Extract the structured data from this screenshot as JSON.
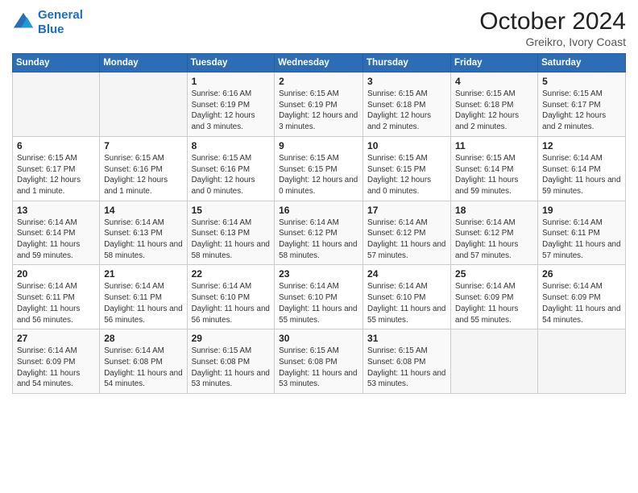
{
  "header": {
    "logo_line1": "General",
    "logo_line2": "Blue",
    "title": "October 2024",
    "location": "Greikro, Ivory Coast"
  },
  "days_of_week": [
    "Sunday",
    "Monday",
    "Tuesday",
    "Wednesday",
    "Thursday",
    "Friday",
    "Saturday"
  ],
  "weeks": [
    [
      {
        "day": "",
        "info": ""
      },
      {
        "day": "",
        "info": ""
      },
      {
        "day": "1",
        "info": "Sunrise: 6:16 AM\nSunset: 6:19 PM\nDaylight: 12 hours and 3 minutes."
      },
      {
        "day": "2",
        "info": "Sunrise: 6:15 AM\nSunset: 6:19 PM\nDaylight: 12 hours and 3 minutes."
      },
      {
        "day": "3",
        "info": "Sunrise: 6:15 AM\nSunset: 6:18 PM\nDaylight: 12 hours and 2 minutes."
      },
      {
        "day": "4",
        "info": "Sunrise: 6:15 AM\nSunset: 6:18 PM\nDaylight: 12 hours and 2 minutes."
      },
      {
        "day": "5",
        "info": "Sunrise: 6:15 AM\nSunset: 6:17 PM\nDaylight: 12 hours and 2 minutes."
      }
    ],
    [
      {
        "day": "6",
        "info": "Sunrise: 6:15 AM\nSunset: 6:17 PM\nDaylight: 12 hours and 1 minute."
      },
      {
        "day": "7",
        "info": "Sunrise: 6:15 AM\nSunset: 6:16 PM\nDaylight: 12 hours and 1 minute."
      },
      {
        "day": "8",
        "info": "Sunrise: 6:15 AM\nSunset: 6:16 PM\nDaylight: 12 hours and 0 minutes."
      },
      {
        "day": "9",
        "info": "Sunrise: 6:15 AM\nSunset: 6:15 PM\nDaylight: 12 hours and 0 minutes."
      },
      {
        "day": "10",
        "info": "Sunrise: 6:15 AM\nSunset: 6:15 PM\nDaylight: 12 hours and 0 minutes."
      },
      {
        "day": "11",
        "info": "Sunrise: 6:15 AM\nSunset: 6:14 PM\nDaylight: 11 hours and 59 minutes."
      },
      {
        "day": "12",
        "info": "Sunrise: 6:14 AM\nSunset: 6:14 PM\nDaylight: 11 hours and 59 minutes."
      }
    ],
    [
      {
        "day": "13",
        "info": "Sunrise: 6:14 AM\nSunset: 6:14 PM\nDaylight: 11 hours and 59 minutes."
      },
      {
        "day": "14",
        "info": "Sunrise: 6:14 AM\nSunset: 6:13 PM\nDaylight: 11 hours and 58 minutes."
      },
      {
        "day": "15",
        "info": "Sunrise: 6:14 AM\nSunset: 6:13 PM\nDaylight: 11 hours and 58 minutes."
      },
      {
        "day": "16",
        "info": "Sunrise: 6:14 AM\nSunset: 6:12 PM\nDaylight: 11 hours and 58 minutes."
      },
      {
        "day": "17",
        "info": "Sunrise: 6:14 AM\nSunset: 6:12 PM\nDaylight: 11 hours and 57 minutes."
      },
      {
        "day": "18",
        "info": "Sunrise: 6:14 AM\nSunset: 6:12 PM\nDaylight: 11 hours and 57 minutes."
      },
      {
        "day": "19",
        "info": "Sunrise: 6:14 AM\nSunset: 6:11 PM\nDaylight: 11 hours and 57 minutes."
      }
    ],
    [
      {
        "day": "20",
        "info": "Sunrise: 6:14 AM\nSunset: 6:11 PM\nDaylight: 11 hours and 56 minutes."
      },
      {
        "day": "21",
        "info": "Sunrise: 6:14 AM\nSunset: 6:11 PM\nDaylight: 11 hours and 56 minutes."
      },
      {
        "day": "22",
        "info": "Sunrise: 6:14 AM\nSunset: 6:10 PM\nDaylight: 11 hours and 56 minutes."
      },
      {
        "day": "23",
        "info": "Sunrise: 6:14 AM\nSunset: 6:10 PM\nDaylight: 11 hours and 55 minutes."
      },
      {
        "day": "24",
        "info": "Sunrise: 6:14 AM\nSunset: 6:10 PM\nDaylight: 11 hours and 55 minutes."
      },
      {
        "day": "25",
        "info": "Sunrise: 6:14 AM\nSunset: 6:09 PM\nDaylight: 11 hours and 55 minutes."
      },
      {
        "day": "26",
        "info": "Sunrise: 6:14 AM\nSunset: 6:09 PM\nDaylight: 11 hours and 54 minutes."
      }
    ],
    [
      {
        "day": "27",
        "info": "Sunrise: 6:14 AM\nSunset: 6:09 PM\nDaylight: 11 hours and 54 minutes."
      },
      {
        "day": "28",
        "info": "Sunrise: 6:14 AM\nSunset: 6:08 PM\nDaylight: 11 hours and 54 minutes."
      },
      {
        "day": "29",
        "info": "Sunrise: 6:15 AM\nSunset: 6:08 PM\nDaylight: 11 hours and 53 minutes."
      },
      {
        "day": "30",
        "info": "Sunrise: 6:15 AM\nSunset: 6:08 PM\nDaylight: 11 hours and 53 minutes."
      },
      {
        "day": "31",
        "info": "Sunrise: 6:15 AM\nSunset: 6:08 PM\nDaylight: 11 hours and 53 minutes."
      },
      {
        "day": "",
        "info": ""
      },
      {
        "day": "",
        "info": ""
      }
    ]
  ]
}
